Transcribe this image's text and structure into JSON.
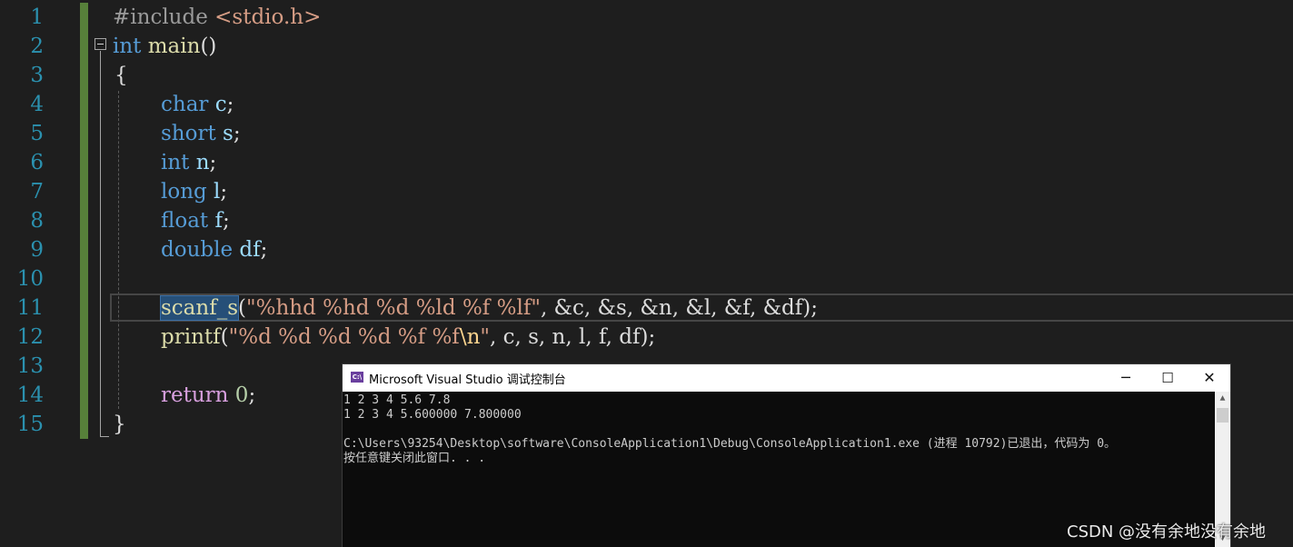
{
  "editor": {
    "line_numbers": [
      "1",
      "2",
      "3",
      "4",
      "5",
      "6",
      "7",
      "8",
      "9",
      "10",
      "11",
      "12",
      "13",
      "14",
      "15"
    ],
    "code": {
      "l1_directive": "#include",
      "l1_header": " <stdio.h>",
      "l2_kw": "int",
      "l2_fn": " main",
      "l2_parens": "()",
      "l3_brace": "{",
      "l4_kw": "char",
      "l4_var": " c",
      "l5_kw": "short",
      "l5_var": " s",
      "l6_kw": "int",
      "l6_var": " n",
      "l7_kw": "long",
      "l7_var": " l",
      "l8_kw": "float",
      "l8_var": " f",
      "l9_kw": "double",
      "l9_var": " df",
      "semi": ";",
      "l11_fn": "scanf_s",
      "l11_open": "(",
      "l11_str": "\"%hhd %hd %d %ld %f %lf\"",
      "l11_args": ", &c, &s, &n, &l, &f, &df",
      "l11_close": ");",
      "l12_fn": "printf",
      "l12_open": "(",
      "l12_str_a": "\"%d %d %d %d %f %f",
      "l12_esc": "\\n",
      "l12_str_b": "\"",
      "l12_args": ", c, s, n, l, f, df",
      "l12_close": ");",
      "l14_kw": "return",
      "l14_num": " 0",
      "l15_brace": "}"
    }
  },
  "console": {
    "title": "Microsoft Visual Studio 调试控制台",
    "icon_text": "C:\\",
    "controls": {
      "minimize": "─",
      "maximize": "☐",
      "close": "✕"
    },
    "lines": [
      "1 2 3 4 5.6 7.8",
      "1 2 3 4 5.600000 7.800000",
      "",
      "C:\\Users\\93254\\Desktop\\software\\ConsoleApplication1\\Debug\\ConsoleApplication1.exe (进程 10792)已退出，代码为 0。",
      "按任意键关闭此窗口. . ."
    ],
    "scroll_up": "▲",
    "scroll_down": "▼"
  },
  "watermark": "CSDN @没有余地没有余地",
  "colors": {
    "background": "#1e1e1e",
    "keyword": "#569cd6",
    "function": "#dcdcaa",
    "variable": "#9cdcfe",
    "string": "#d69d85",
    "line_number": "#2b91af",
    "change_bar": "#57803a",
    "selection": "#264f78"
  }
}
